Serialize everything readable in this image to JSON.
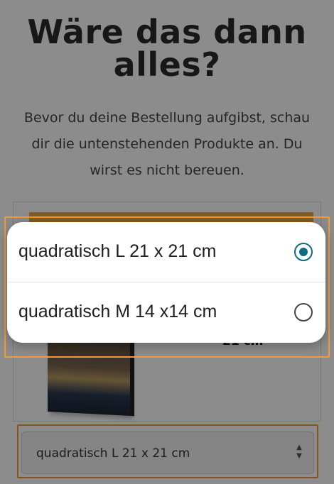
{
  "page": {
    "headline": "Wäre das dann alles?",
    "subtext": "Bevor du deine Bestellung aufgibst, schau dir die untenstehenden Produkte an. Du wirst es nicht bereuen.",
    "product_size_hint": "21 cm"
  },
  "size_select": {
    "selected_value": "quadratisch L 21 x 21 cm"
  },
  "dialog": {
    "options": [
      {
        "label": "quadratisch L 21 x 21 cm",
        "selected": true
      },
      {
        "label": "quadratisch M 14 x14 cm",
        "selected": false
      }
    ]
  },
  "colors": {
    "accent_orange": "#f29b3d",
    "radio_checked": "#0f6a83",
    "promo_banner": "#f0a73a"
  }
}
